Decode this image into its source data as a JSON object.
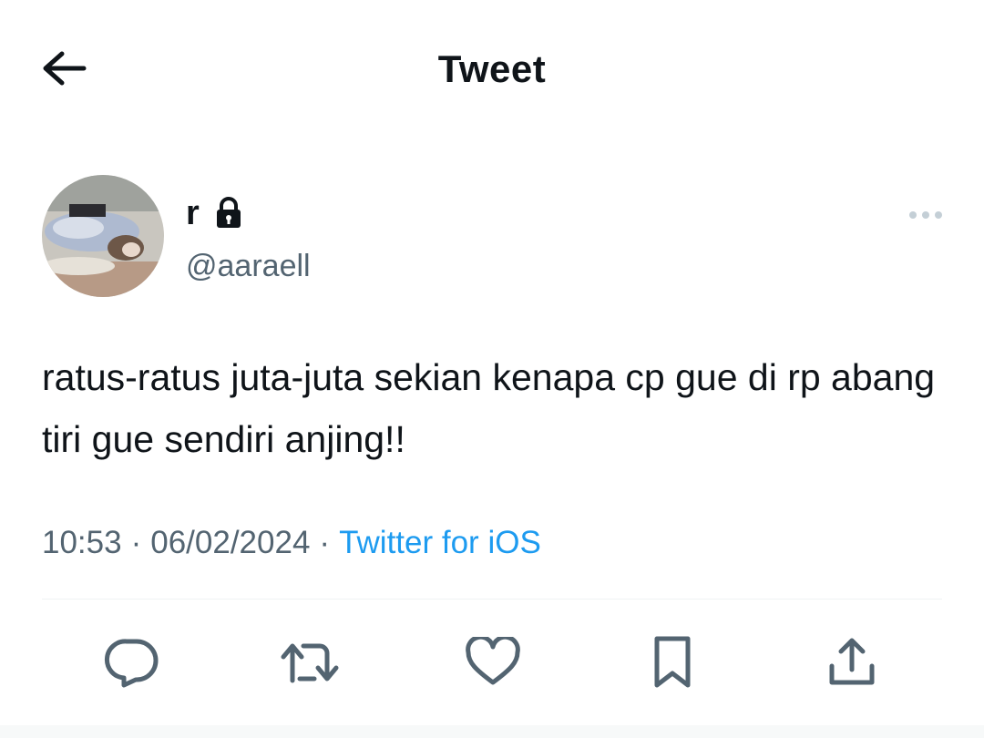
{
  "header": {
    "title": "Tweet",
    "back_icon": "arrow-left-icon"
  },
  "author": {
    "display_name": "r",
    "protected_icon": "lock-icon",
    "handle": "@aaraell",
    "avatar_icon": "profile-photo"
  },
  "more_icon": "more-horizontal-icon",
  "tweet": {
    "text": "ratus-ratus juta-juta sekian kenapa cp gue di rp abang tiri gue sendiri anjing!!"
  },
  "meta": {
    "time": "10:53",
    "separator": "·",
    "date": "06/02/2024",
    "source": "Twitter for iOS"
  },
  "actions": [
    {
      "icon": "reply-icon"
    },
    {
      "icon": "retweet-icon"
    },
    {
      "icon": "like-icon"
    },
    {
      "icon": "bookmark-icon"
    },
    {
      "icon": "share-icon"
    }
  ],
  "colors": {
    "text": "#0f1419",
    "secondary": "#536471",
    "link": "#1d9bf0",
    "icon": "#536471",
    "divider": "#eff3f4"
  }
}
